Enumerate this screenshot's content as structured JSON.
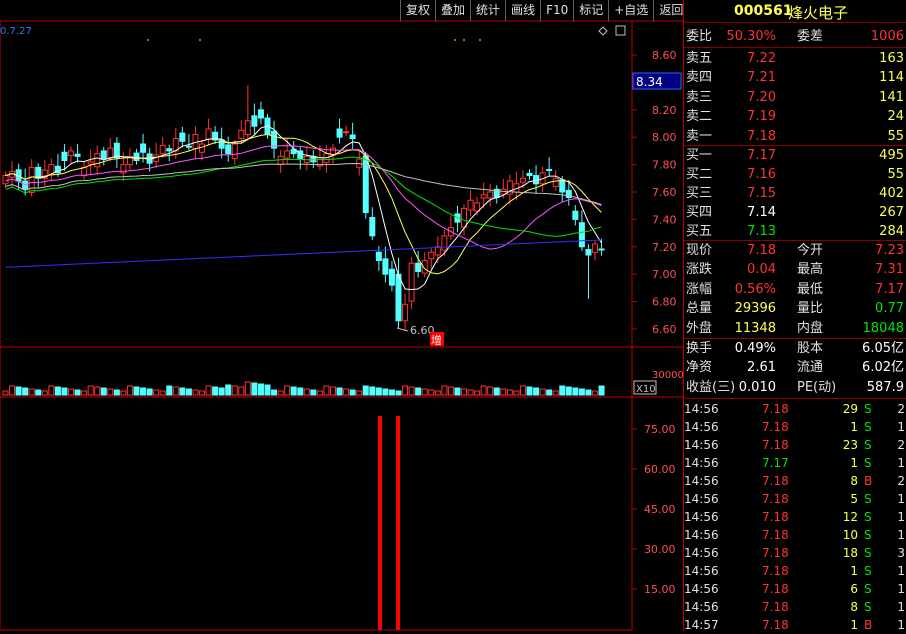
{
  "toolbar": [
    "复权",
    "叠加",
    "统计",
    "画线",
    "F10",
    "标记",
    "+自选",
    "返回"
  ],
  "chart": {
    "corner_label": "0.7.27",
    "current_price_tag": "8.34",
    "low_annotation": "6.60",
    "zeng_label": "增",
    "price_axis": [
      "8.60",
      "8.40",
      "8.20",
      "8.00",
      "7.80",
      "7.60",
      "7.40",
      "7.20",
      "7.00",
      "6.80",
      "6.60"
    ],
    "volume_axis": "30000",
    "volume_unit": "X10",
    "indicator_axis": [
      "75.00",
      "60.00",
      "45.00",
      "30.00",
      "15.00"
    ],
    "colors": {
      "up": "#ff3232",
      "down": "#54ffff",
      "ma5": "#ffffff",
      "ma10": "#ffff54",
      "ma20": "#ff54ff",
      "ma30": "#00e600",
      "ma60": "#c0c0c0",
      "ma250": "#3030ff",
      "frame": "#c00000"
    }
  },
  "stock": {
    "code": "000561",
    "name": "烽火电子"
  },
  "order_book": {
    "weibi_label": "委比",
    "weibi": "50.30%",
    "weicha_label": "委差",
    "weicha": "1006",
    "asks": [
      {
        "label": "卖五",
        "price": "7.22",
        "vol": "163"
      },
      {
        "label": "卖四",
        "price": "7.21",
        "vol": "114"
      },
      {
        "label": "卖三",
        "price": "7.20",
        "vol": "141"
      },
      {
        "label": "卖二",
        "price": "7.19",
        "vol": "24"
      },
      {
        "label": "卖一",
        "price": "7.18",
        "vol": "55"
      }
    ],
    "bids": [
      {
        "label": "买一",
        "price": "7.17",
        "vol": "495"
      },
      {
        "label": "买二",
        "price": "7.16",
        "vol": "55"
      },
      {
        "label": "买三",
        "price": "7.15",
        "vol": "402"
      },
      {
        "label": "买四",
        "price": "7.14",
        "vol": "267"
      },
      {
        "label": "买五",
        "price": "7.13",
        "vol": "284"
      }
    ]
  },
  "quote": [
    {
      "l1": "现价",
      "v1": "7.18",
      "l2": "今开",
      "v2": "7.23"
    },
    {
      "l1": "涨跌",
      "v1": "0.04",
      "l2": "最高",
      "v2": "7.31"
    },
    {
      "l1": "涨幅",
      "v1": "0.56%",
      "l2": "最低",
      "v2": "7.17"
    },
    {
      "l1": "总量",
      "v1": "29396",
      "l2": "量比",
      "v2": "0.77"
    },
    {
      "l1": "外盘",
      "v1": "11348",
      "l2": "内盘",
      "v2": "18048"
    }
  ],
  "stats": [
    {
      "l1": "换手",
      "v1": "0.49%",
      "l2": "股本",
      "v2": "6.05亿"
    },
    {
      "l1": "净资",
      "v1": "2.61",
      "l2": "流通",
      "v2": "6.02亿"
    },
    {
      "l1": "收益(三)",
      "v1": "0.010",
      "l2": "PE(动)",
      "v2": "587.9"
    }
  ],
  "ticks": [
    {
      "t": "14:56",
      "p": "7.18",
      "v": "29",
      "bs": "S",
      "n": "2"
    },
    {
      "t": "14:56",
      "p": "7.18",
      "v": "1",
      "bs": "S",
      "n": "1"
    },
    {
      "t": "14:56",
      "p": "7.18",
      "v": "23",
      "bs": "S",
      "n": "2"
    },
    {
      "t": "14:56",
      "p": "7.17",
      "v": "1",
      "bs": "S",
      "n": "1"
    },
    {
      "t": "14:56",
      "p": "7.18",
      "v": "8",
      "bs": "B",
      "n": "2"
    },
    {
      "t": "14:56",
      "p": "7.18",
      "v": "5",
      "bs": "S",
      "n": "1"
    },
    {
      "t": "14:56",
      "p": "7.18",
      "v": "12",
      "bs": "S",
      "n": "1"
    },
    {
      "t": "14:56",
      "p": "7.18",
      "v": "10",
      "bs": "S",
      "n": "1"
    },
    {
      "t": "14:56",
      "p": "7.18",
      "v": "18",
      "bs": "S",
      "n": "3"
    },
    {
      "t": "14:56",
      "p": "7.18",
      "v": "1",
      "bs": "S",
      "n": "1"
    },
    {
      "t": "14:56",
      "p": "7.18",
      "v": "6",
      "bs": "S",
      "n": "1"
    },
    {
      "t": "14:56",
      "p": "7.18",
      "v": "8",
      "bs": "S",
      "n": "1"
    },
    {
      "t": "14:57",
      "p": "7.18",
      "v": "1",
      "bs": "B",
      "n": "1"
    }
  ]
}
